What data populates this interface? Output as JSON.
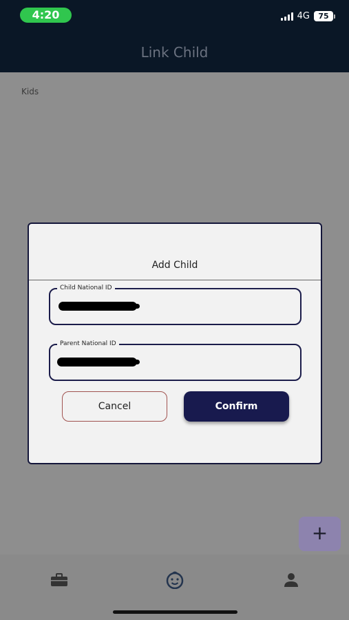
{
  "status_bar": {
    "time": "4:20",
    "network": "4G",
    "battery": "75"
  },
  "header": {
    "title": "Link Child"
  },
  "page": {
    "section_label": "Kids"
  },
  "dialog": {
    "title": "Add Child",
    "fields": [
      {
        "label": "Child National ID"
      },
      {
        "label": "Parent National ID"
      }
    ],
    "cancel_label": "Cancel",
    "confirm_label": "Confirm"
  },
  "fab": {
    "label": "+"
  },
  "bottom_nav": {
    "items": [
      {
        "icon": "briefcase-icon"
      },
      {
        "icon": "child-face-icon"
      },
      {
        "icon": "profile-icon"
      }
    ]
  },
  "colors": {
    "header_bg": "#0a1726",
    "time_pill": "#30c64e",
    "primary": "#181a4e",
    "cancel_border": "#a0524f",
    "fab": "#8d83ae",
    "active_nav": "#23344e"
  }
}
